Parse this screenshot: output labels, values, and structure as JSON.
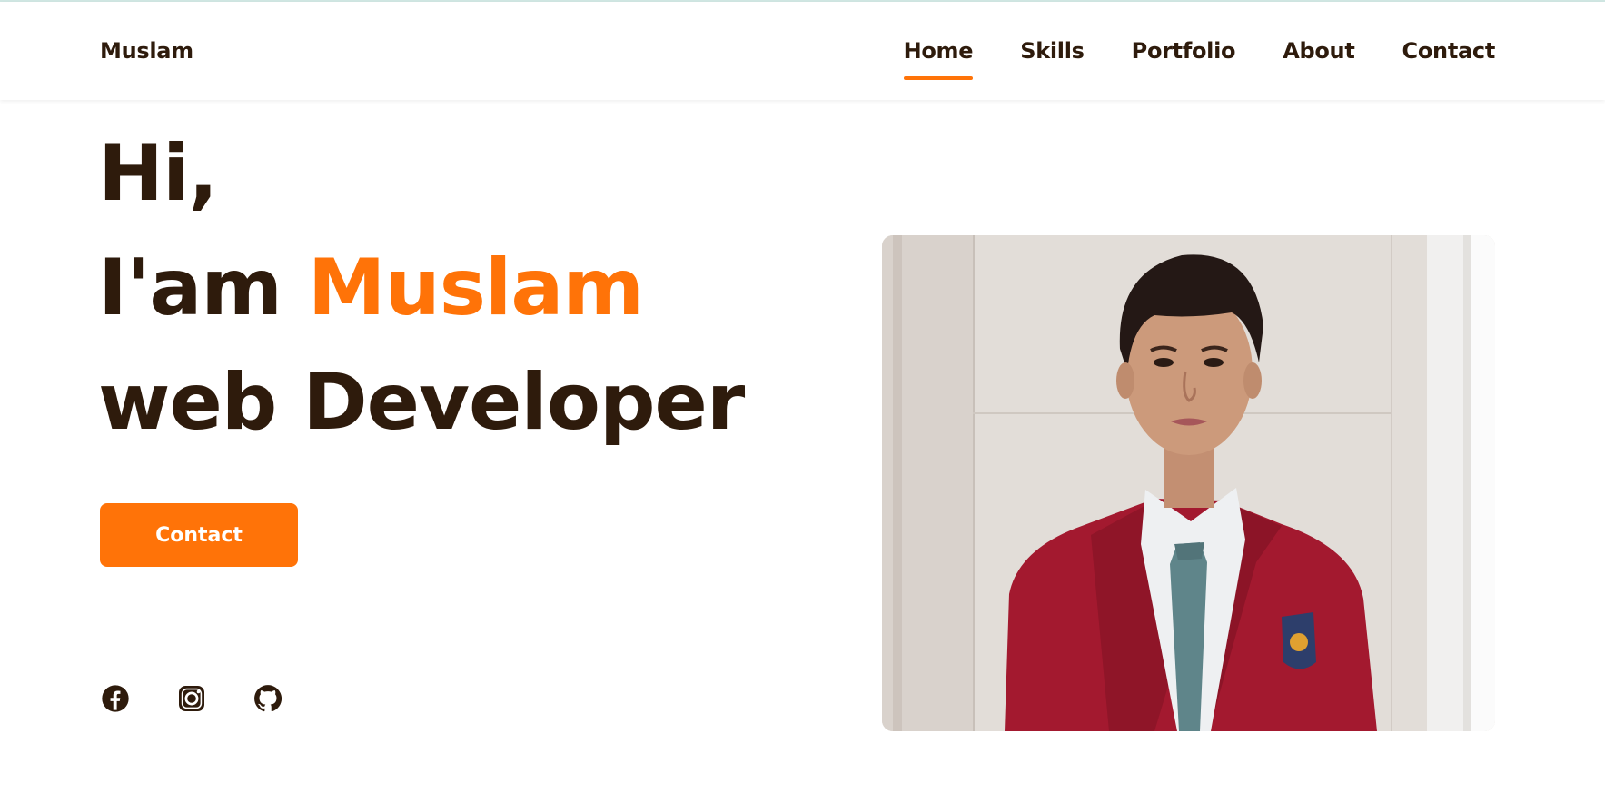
{
  "header": {
    "logo": "Muslam",
    "nav": [
      {
        "label": "Home",
        "active": true
      },
      {
        "label": "Skills",
        "active": false
      },
      {
        "label": "Portfolio",
        "active": false
      },
      {
        "label": "About",
        "active": false
      },
      {
        "label": "Contact",
        "active": false
      }
    ]
  },
  "hero": {
    "line1": "Hi,",
    "line2_prefix": "I'am ",
    "line2_name": "Muslam",
    "line3": "web Developer",
    "button_label": "Contact"
  },
  "socials": [
    {
      "icon": "facebook-icon"
    },
    {
      "icon": "instagram-icon"
    },
    {
      "icon": "github-icon"
    }
  ],
  "colors": {
    "accent": "#ff7308",
    "text": "#2e1b0c",
    "background": "#ffffff"
  }
}
